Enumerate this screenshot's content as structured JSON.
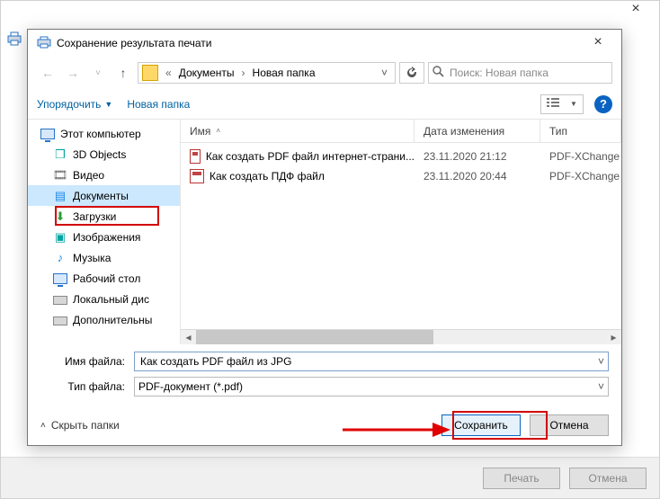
{
  "bg": {
    "print_label": "Печать",
    "cancel_label": "Отмена"
  },
  "dialog": {
    "title": "Сохранение результата печати",
    "breadcrumb": {
      "level1": "Документы",
      "level2": "Новая папка"
    },
    "search_placeholder": "Поиск: Новая папка",
    "toolbar": {
      "organize": "Упорядочить",
      "newfolder": "Новая папка"
    },
    "columns": {
      "name": "Имя",
      "date": "Дата изменения",
      "type": "Тип"
    },
    "nav": {
      "root": "Этот компьютер",
      "items": [
        {
          "label": "3D Objects",
          "icon": "cube",
          "cls": "c-teal"
        },
        {
          "label": "Видео",
          "icon": "film",
          "cls": "c-gray"
        },
        {
          "label": "Документы",
          "icon": "doc",
          "cls": "c-blue",
          "selected": true
        },
        {
          "label": "Загрузки",
          "icon": "down",
          "cls": "c-green"
        },
        {
          "label": "Изображения",
          "icon": "img",
          "cls": "c-teal"
        },
        {
          "label": "Музыка",
          "icon": "note",
          "cls": "c-blue"
        },
        {
          "label": "Рабочий стол",
          "icon": "desk",
          "cls": "c-blue"
        },
        {
          "label": "Локальный дис",
          "icon": "drv",
          "cls": ""
        },
        {
          "label": "Дополнительны",
          "icon": "drv",
          "cls": ""
        }
      ]
    },
    "files": [
      {
        "name": "Как создать PDF файл интернет-страни...",
        "date": "23.11.2020 21:12",
        "type": "PDF-XChange V"
      },
      {
        "name": "Как создать ПДФ файл",
        "date": "23.11.2020 20:44",
        "type": "PDF-XChange V"
      }
    ],
    "filename_label": "Имя файла:",
    "filename_value": "Как создать PDF файл из JPG",
    "filetype_label": "Тип файла:",
    "filetype_value": "PDF-документ (*.pdf)",
    "hide_folders": "Скрыть папки",
    "save_label": "Сохранить",
    "cancel_label": "Отмена"
  }
}
